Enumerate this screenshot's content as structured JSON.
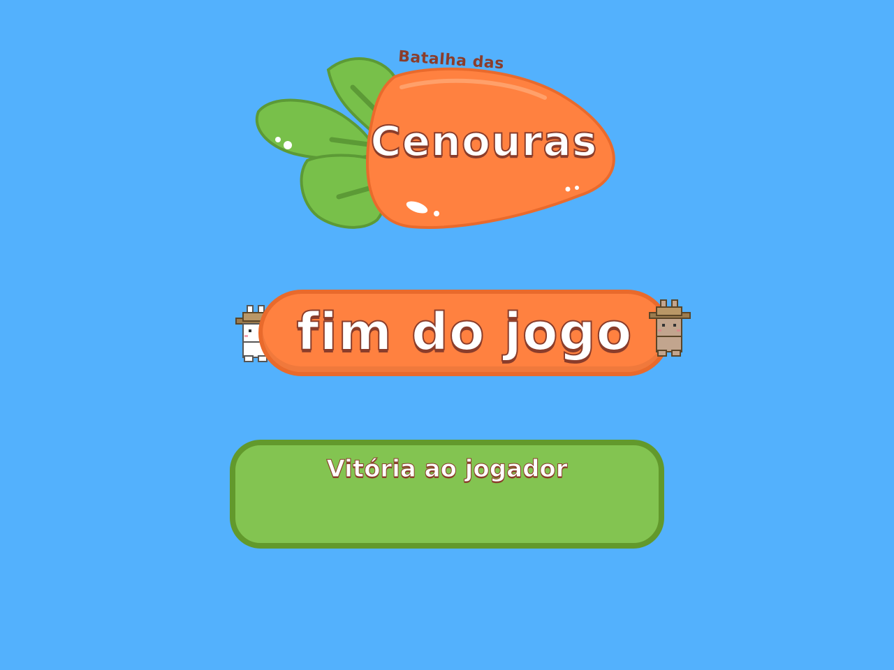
{
  "logo": {
    "line_small": "Batalha das",
    "line_big": "Cenouras"
  },
  "banner": {
    "title": "fim do jogo"
  },
  "result": {
    "message": "Vitória ao jogador"
  },
  "colors": {
    "background": "#53b1fd",
    "carrot": "#ff8140",
    "leaf": "#78c04a",
    "result_box": "#83c451",
    "outline_brown": "#8a3d2b"
  },
  "icons": [
    "carrot-logo-icon",
    "bunny-farmer-white-icon",
    "bunny-farmer-brown-icon"
  ]
}
